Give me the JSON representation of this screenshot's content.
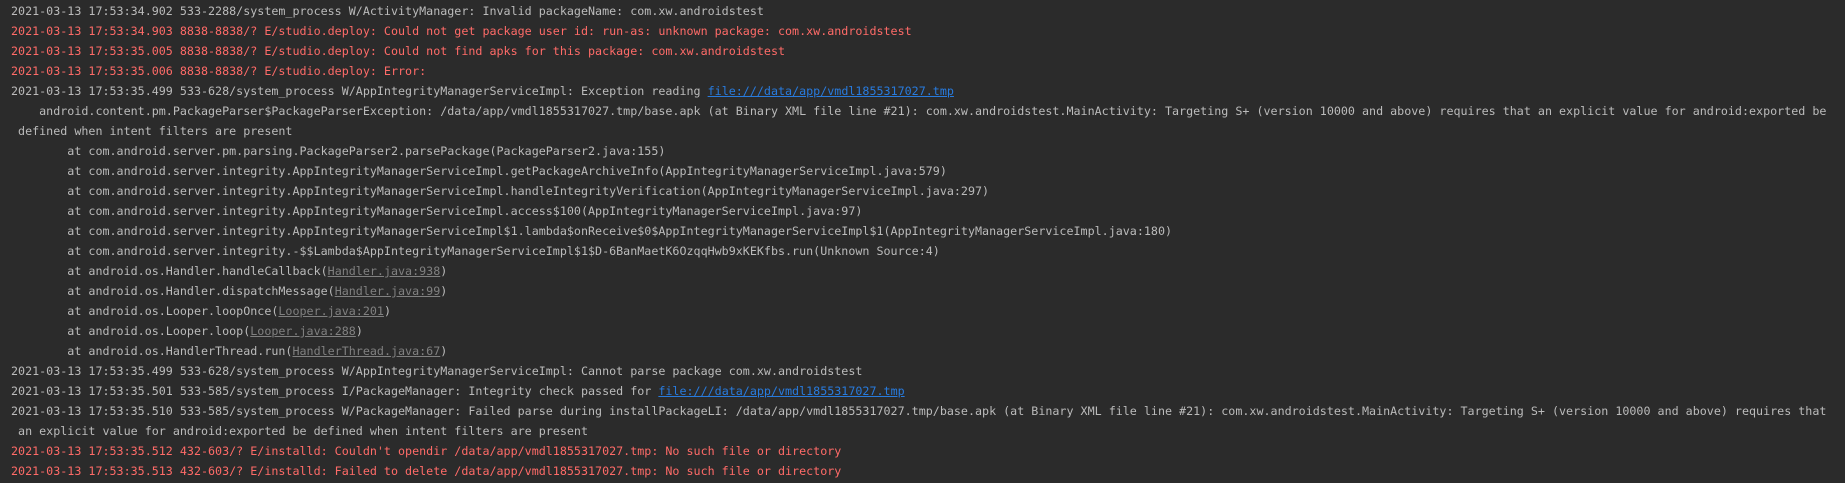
{
  "lines": [
    {
      "level": "W",
      "parts": [
        {
          "t": "2021-03-13 17:53:34.902 533-2288/system_process W/ActivityManager: Invalid packageName: com.xw.androidstest"
        }
      ]
    },
    {
      "level": "E",
      "parts": [
        {
          "t": "2021-03-13 17:53:34.903 8838-8838/? E/studio.deploy: Could not get package user id: run-as: unknown package: com.xw.androidstest"
        }
      ]
    },
    {
      "level": "E",
      "parts": [
        {
          "t": "2021-03-13 17:53:35.005 8838-8838/? E/studio.deploy: Could not find apks for this package: com.xw.androidstest"
        }
      ]
    },
    {
      "level": "E",
      "parts": [
        {
          "t": "2021-03-13 17:53:35.006 8838-8838/? E/studio.deploy: Error:"
        }
      ]
    },
    {
      "level": "W",
      "parts": [
        {
          "t": "2021-03-13 17:53:35.499 533-628/system_process W/AppIntegrityManagerServiceImpl: Exception reading "
        },
        {
          "t": "file:///data/app/vmdl1855317027.tmp",
          "link": "url"
        }
      ]
    },
    {
      "level": "W",
      "parts": [
        {
          "t": "    android.content.pm.PackageParser$PackageParserException: /data/app/vmdl1855317027.tmp/base.apk (at Binary XML file line #21): com.xw.androidstest.MainActivity: Targeting S+ (version 10000 and above) requires that an explicit value for android:exported be"
        }
      ]
    },
    {
      "level": "W",
      "parts": [
        {
          "t": " defined when intent filters are present"
        }
      ]
    },
    {
      "level": "W",
      "parts": [
        {
          "t": "        at com.android.server.pm.parsing.PackageParser2.parsePackage(PackageParser2.java:155)"
        }
      ]
    },
    {
      "level": "W",
      "parts": [
        {
          "t": "        at com.android.server.integrity.AppIntegrityManagerServiceImpl.getPackageArchiveInfo(AppIntegrityManagerServiceImpl.java:579)"
        }
      ]
    },
    {
      "level": "W",
      "parts": [
        {
          "t": "        at com.android.server.integrity.AppIntegrityManagerServiceImpl.handleIntegrityVerification(AppIntegrityManagerServiceImpl.java:297)"
        }
      ]
    },
    {
      "level": "W",
      "parts": [
        {
          "t": "        at com.android.server.integrity.AppIntegrityManagerServiceImpl.access$100(AppIntegrityManagerServiceImpl.java:97)"
        }
      ]
    },
    {
      "level": "W",
      "parts": [
        {
          "t": "        at com.android.server.integrity.AppIntegrityManagerServiceImpl$1.lambda$onReceive$0$AppIntegrityManagerServiceImpl$1(AppIntegrityManagerServiceImpl.java:180)"
        }
      ]
    },
    {
      "level": "W",
      "parts": [
        {
          "t": "        at com.android.server.integrity.-$$Lambda$AppIntegrityManagerServiceImpl$1$D-6BanMaetK6OzqqHwb9xKEKfbs.run(Unknown Source:4)"
        }
      ]
    },
    {
      "level": "W",
      "parts": [
        {
          "t": "        at android.os.Handler.handleCallback("
        },
        {
          "t": "Handler.java:938",
          "link": "src"
        },
        {
          "t": ")"
        }
      ]
    },
    {
      "level": "W",
      "parts": [
        {
          "t": "        at android.os.Handler.dispatchMessage("
        },
        {
          "t": "Handler.java:99",
          "link": "src"
        },
        {
          "t": ")"
        }
      ]
    },
    {
      "level": "W",
      "parts": [
        {
          "t": "        at android.os.Looper.loopOnce("
        },
        {
          "t": "Looper.java:201",
          "link": "src"
        },
        {
          "t": ")"
        }
      ]
    },
    {
      "level": "W",
      "parts": [
        {
          "t": "        at android.os.Looper.loop("
        },
        {
          "t": "Looper.java:288",
          "link": "src"
        },
        {
          "t": ")"
        }
      ]
    },
    {
      "level": "W",
      "parts": [
        {
          "t": "        at android.os.HandlerThread.run("
        },
        {
          "t": "HandlerThread.java:67",
          "link": "src"
        },
        {
          "t": ")"
        }
      ]
    },
    {
      "level": "W",
      "parts": [
        {
          "t": "2021-03-13 17:53:35.499 533-628/system_process W/AppIntegrityManagerServiceImpl: Cannot parse package com.xw.androidstest"
        }
      ]
    },
    {
      "level": "I",
      "parts": [
        {
          "t": "2021-03-13 17:53:35.501 533-585/system_process I/PackageManager: Integrity check passed for "
        },
        {
          "t": "file:///data/app/vmdl1855317027.tmp",
          "link": "url"
        }
      ]
    },
    {
      "level": "W",
      "parts": [
        {
          "t": "2021-03-13 17:53:35.510 533-585/system_process W/PackageManager: Failed parse during installPackageLI: /data/app/vmdl1855317027.tmp/base.apk (at Binary XML file line #21): com.xw.androidstest.MainActivity: Targeting S+ (version 10000 and above) requires that"
        }
      ]
    },
    {
      "level": "W",
      "parts": [
        {
          "t": " an explicit value for android:exported be defined when intent filters are present"
        }
      ]
    },
    {
      "level": "E",
      "parts": [
        {
          "t": "2021-03-13 17:53:35.512 432-603/? E/installd: Couldn't opendir /data/app/vmdl1855317027.tmp: No such file or directory"
        }
      ]
    },
    {
      "level": "E",
      "parts": [
        {
          "t": "2021-03-13 17:53:35.513 432-603/? E/installd: Failed to delete /data/app/vmdl1855317027.tmp: No such file or directory"
        }
      ]
    }
  ],
  "colors": {
    "background": "#2b2b2b",
    "default_text": "#bbbbbb",
    "error_text": "#ff6b68",
    "url_link": "#287bde",
    "source_link": "#808080"
  }
}
